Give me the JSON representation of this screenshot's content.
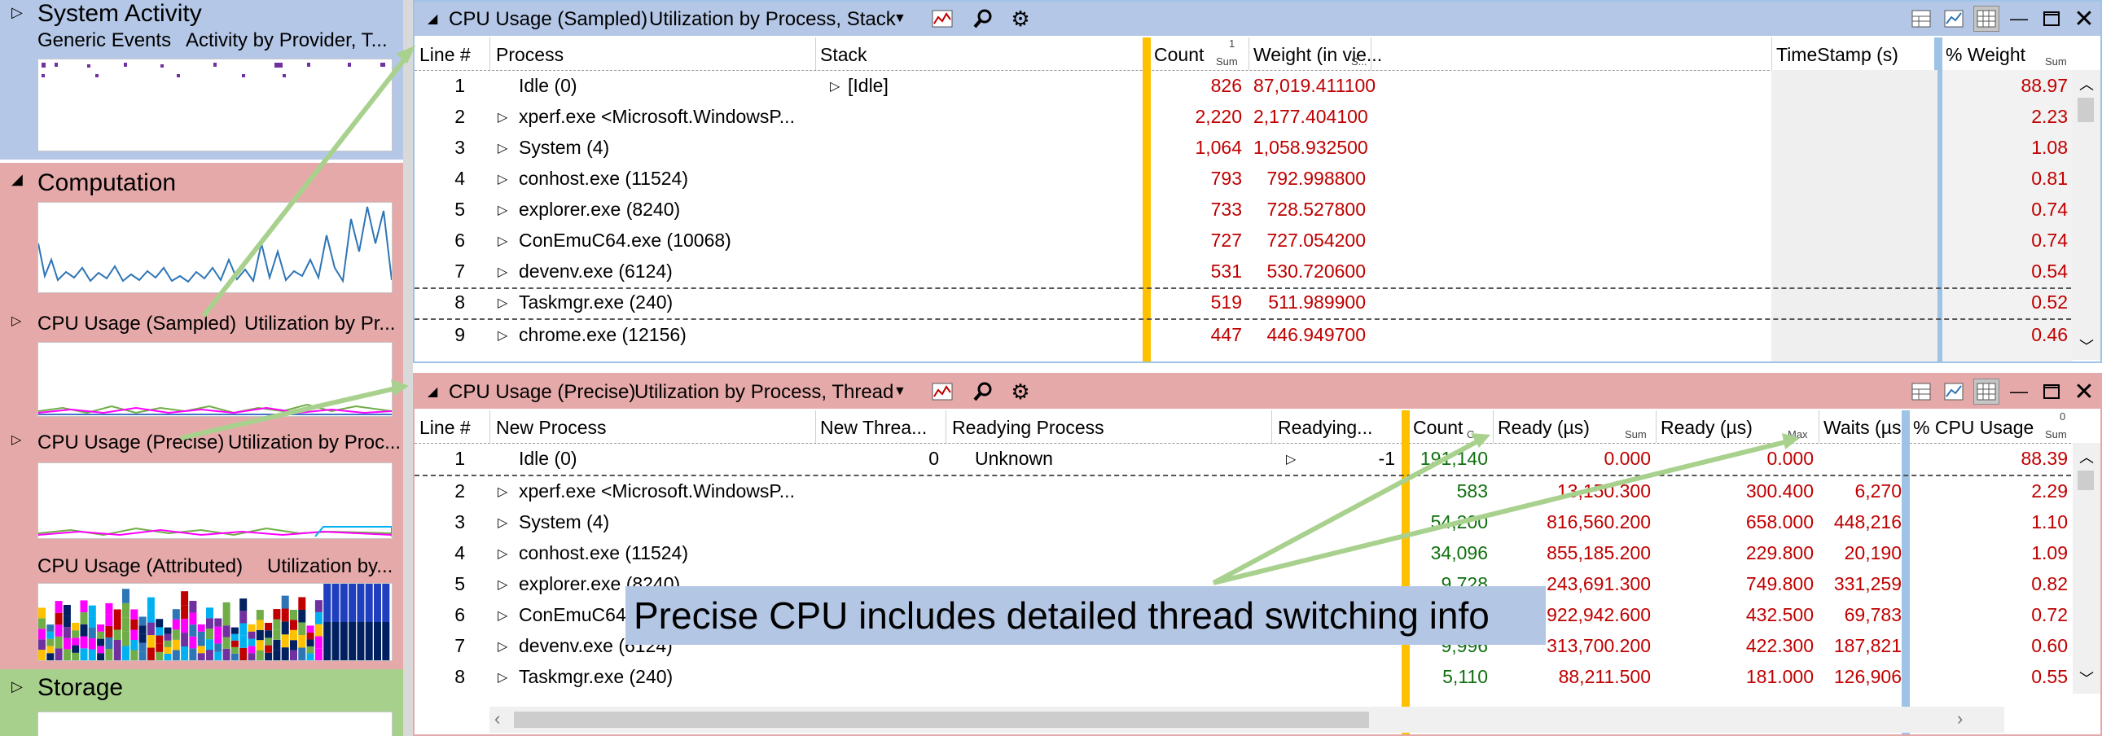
{
  "colors": {
    "system_activity_bg": "#b4c7e7",
    "computation_bg": "#e6a9a9",
    "storage_bg": "#a8d08d",
    "sampled_title_bg": "#b4c7e7",
    "precise_title_bg": "#e6a9a9",
    "yellow_stripe": "#ffc000",
    "blue_stripe": "#9dc3e6",
    "arrow": "#a9d18e",
    "callout_bg": "#b3c6e4",
    "value_red": "#c00000",
    "value_green": "#107010"
  },
  "sidebar": {
    "system_activity": {
      "label": "System Activity",
      "graph": "Generic Events",
      "preset": "Activity by Provider, T..."
    },
    "computation": {
      "label": "Computation"
    },
    "cpu_sampled": {
      "graph": "CPU Usage (Sampled)",
      "preset": "Utilization by Pr..."
    },
    "cpu_precise": {
      "graph": "CPU Usage (Precise)",
      "preset": "Utilization by Proc..."
    },
    "cpu_attributed": {
      "graph": "CPU Usage (Attributed)",
      "preset": "Utilization by..."
    },
    "storage": {
      "label": "Storage"
    }
  },
  "sampled": {
    "title": "CPU Usage (Sampled)",
    "preset": "Utilization by Process, Stack",
    "icons": [
      "graph-icon",
      "search-icon",
      "settings-icon",
      "chart-table-icon",
      "chart-icon",
      "table-icon",
      "minimize-icon",
      "maximize-icon",
      "close-icon"
    ],
    "headers": {
      "line": "Line #",
      "process": "Process",
      "stack": "Stack",
      "count": "Count",
      "count_sub": "Sum",
      "count_sort": "1",
      "weight": "Weight (in vie...",
      "weight_sub": "S...",
      "timestamp": "TimeStamp (s)",
      "pct": "% Weight",
      "pct_sub": "Sum"
    },
    "rows": [
      {
        "line": "1",
        "process": "Idle (0)",
        "stack": "[Idle]",
        "count": "826",
        "weight": "87,019.411100",
        "pct": "88.97"
      },
      {
        "line": "2",
        "process": "xperf.exe <Microsoft.WindowsP...",
        "stack": "",
        "count": "2,220",
        "weight": "2,177.404100",
        "pct": "2.23"
      },
      {
        "line": "3",
        "process": "System (4)",
        "stack": "",
        "count": "1,064",
        "weight": "1,058.932500",
        "pct": "1.08"
      },
      {
        "line": "4",
        "process": "conhost.exe (11524)",
        "stack": "",
        "count": "793",
        "weight": "792.998800",
        "pct": "0.81"
      },
      {
        "line": "5",
        "process": "explorer.exe (8240)",
        "stack": "",
        "count": "733",
        "weight": "728.527800",
        "pct": "0.74"
      },
      {
        "line": "6",
        "process": "ConEmuC64.exe (10068)",
        "stack": "",
        "count": "727",
        "weight": "727.054200",
        "pct": "0.74"
      },
      {
        "line": "7",
        "process": "devenv.exe (6124)",
        "stack": "",
        "count": "531",
        "weight": "530.720600",
        "pct": "0.54"
      },
      {
        "line": "8",
        "process": "Taskmgr.exe (240)",
        "stack": "",
        "count": "519",
        "weight": "511.989900",
        "pct": "0.52"
      },
      {
        "line": "9",
        "process": "chrome.exe (12156)",
        "stack": "",
        "count": "447",
        "weight": "446.949700",
        "pct": "0.46"
      }
    ]
  },
  "precise": {
    "title": "CPU Usage (Precise)",
    "preset": "Utilization by Process, Thread",
    "headers": {
      "line": "Line #",
      "new_process": "New Process",
      "new_thread": "New Threa...",
      "readying_process": "Readying Process",
      "readying": "Readying...",
      "count": "Count",
      "count_sub": "C",
      "ready_sum": "Ready (µs)",
      "ready_sum_sub": "Sum",
      "ready_max": "Ready (µs)",
      "ready_max_sub": "Max",
      "waits": "Waits (µs",
      "pct": "% CPU Usage",
      "pct_sub": "Sum",
      "pct_sort": "0"
    },
    "rows": [
      {
        "line": "1",
        "process": "Idle (0)",
        "new_thread": "0",
        "readying_process": "Unknown",
        "readying": "-1",
        "count": "191,140",
        "ready_sum": "0.000",
        "ready_max": "0.000",
        "waits": "",
        "pct": "88.39"
      },
      {
        "line": "2",
        "process": "xperf.exe <Microsoft.WindowsP...",
        "new_thread": "",
        "readying_process": "",
        "readying": "",
        "count": "583",
        "ready_sum": "13,150.300",
        "ready_max": "300.400",
        "waits": "6,270",
        "pct": "2.29"
      },
      {
        "line": "3",
        "process": "System (4)",
        "new_thread": "",
        "readying_process": "",
        "readying": "",
        "count": "54,200",
        "ready_sum": "816,560.200",
        "ready_max": "658.000",
        "waits": "448,216",
        "pct": "1.10"
      },
      {
        "line": "4",
        "process": "conhost.exe (11524)",
        "new_thread": "",
        "readying_process": "",
        "readying": "",
        "count": "34,096",
        "ready_sum": "855,185.200",
        "ready_max": "229.800",
        "waits": "20,190",
        "pct": "1.09"
      },
      {
        "line": "5",
        "process": "explorer.exe (8240)",
        "new_thread": "",
        "readying_process": "",
        "readying": "",
        "count": "9,728",
        "ready_sum": "243,691.300",
        "ready_max": "749.800",
        "waits": "331,259",
        "pct": "0.82"
      },
      {
        "line": "6",
        "process": "ConEmuC64",
        "new_thread": "",
        "readying_process": "",
        "readying": "",
        "count": "",
        "ready_sum": "922,942.600",
        "ready_max": "432.500",
        "waits": "69,783",
        "pct": "0.72"
      },
      {
        "line": "7",
        "process": "devenv.exe (6124)",
        "new_thread": "",
        "readying_process": "",
        "readying": "",
        "count": "9,996",
        "ready_sum": "313,700.200",
        "ready_max": "422.300",
        "waits": "187,821",
        "pct": "0.60"
      },
      {
        "line": "8",
        "process": "Taskmgr.exe (240)",
        "new_thread": "",
        "readying_process": "",
        "readying": "",
        "count": "5,110",
        "ready_sum": "88,211.500",
        "ready_max": "181.000",
        "waits": "126,906",
        "pct": "0.55"
      }
    ]
  },
  "callout": "Precise CPU includes detailed thread switching info"
}
